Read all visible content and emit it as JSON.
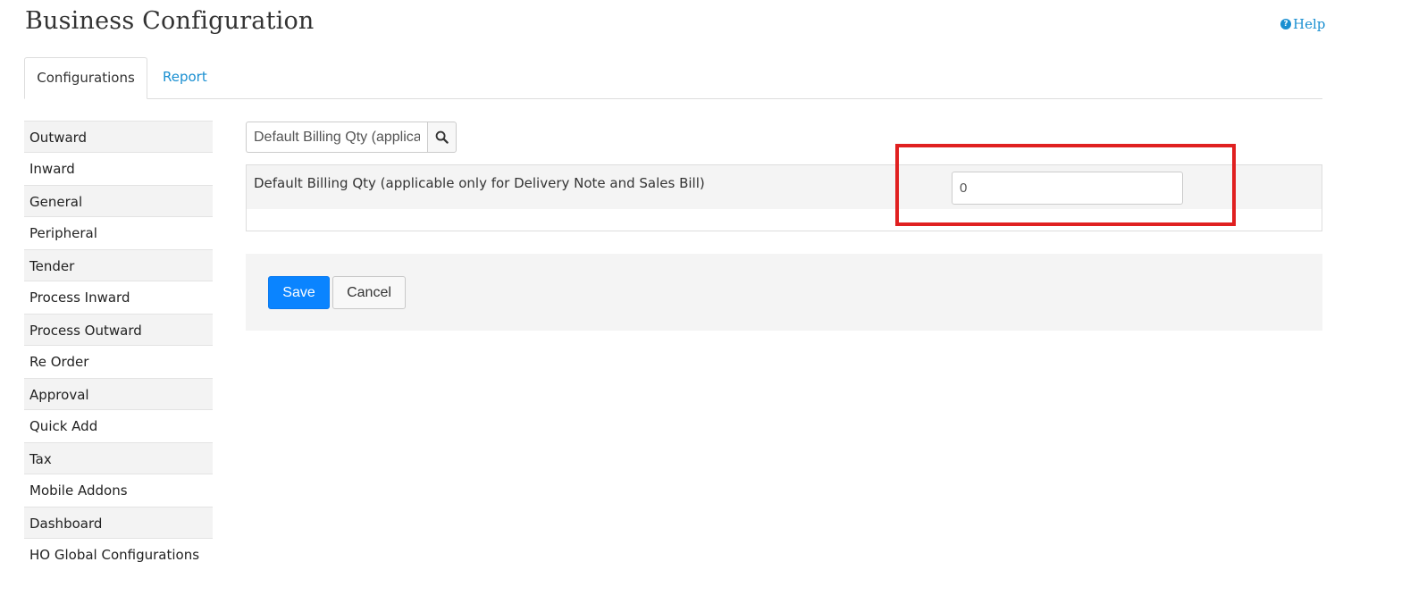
{
  "header": {
    "title": "Business Configuration",
    "help_label": "Help"
  },
  "tabs": [
    {
      "label": "Configurations",
      "active": true
    },
    {
      "label": "Report",
      "active": false
    }
  ],
  "sidebar": {
    "items": [
      {
        "label": "Outward"
      },
      {
        "label": "Inward"
      },
      {
        "label": "General"
      },
      {
        "label": "Peripheral"
      },
      {
        "label": "Tender"
      },
      {
        "label": "Process Inward"
      },
      {
        "label": "Process Outward"
      },
      {
        "label": "Re Order"
      },
      {
        "label": "Approval"
      },
      {
        "label": "Quick Add"
      },
      {
        "label": "Tax"
      },
      {
        "label": "Mobile Addons"
      },
      {
        "label": "Dashboard"
      },
      {
        "label": "HO Global Configurations"
      }
    ]
  },
  "search": {
    "value": "Default Billing Qty (applica",
    "icon": "search-icon"
  },
  "config": {
    "label": "Default Billing Qty (applicable only for Delivery Note and Sales Bill)",
    "value": "0"
  },
  "actions": {
    "save_label": "Save",
    "cancel_label": "Cancel"
  },
  "colors": {
    "accent": "#1a8fd1",
    "primary_button": "#0a84ff",
    "highlight": "#e02020"
  }
}
